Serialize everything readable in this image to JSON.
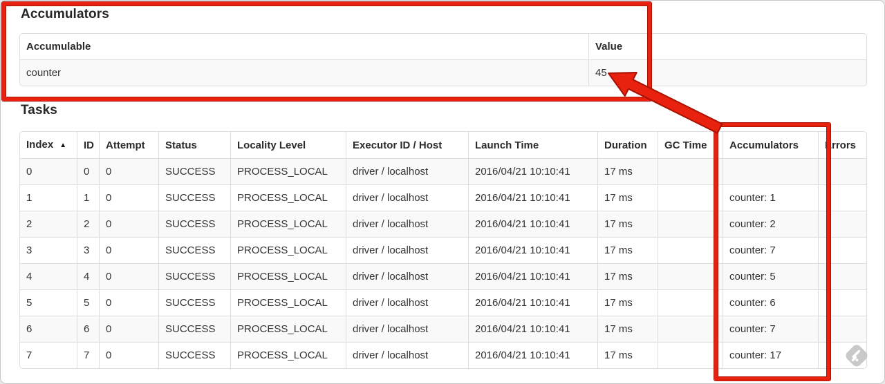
{
  "frame": {
    "background": "#ffffff",
    "border_color": "#c6c6c6"
  },
  "accumulators_section": {
    "title": "Accumulators",
    "table": {
      "columns": [
        "Accumulable",
        "Value"
      ],
      "sorted_column": "",
      "sort_icon": "",
      "rows": [
        [
          "counter",
          "45"
        ]
      ]
    }
  },
  "tasks_section": {
    "title": "Tasks",
    "table": {
      "columns": [
        "Index",
        "ID",
        "Attempt",
        "Status",
        "Locality Level",
        "Executor ID / Host",
        "Launch Time",
        "Duration",
        "GC Time",
        "Accumulators",
        "Errors"
      ],
      "sorted_column": "Index",
      "sort_icon": "▲",
      "rows": [
        [
          "0",
          "0",
          "0",
          "SUCCESS",
          "PROCESS_LOCAL",
          "driver / localhost",
          "2016/04/21 10:10:41",
          "17 ms",
          "",
          "",
          ""
        ],
        [
          "1",
          "1",
          "0",
          "SUCCESS",
          "PROCESS_LOCAL",
          "driver / localhost",
          "2016/04/21 10:10:41",
          "17 ms",
          "",
          "counter: 1",
          ""
        ],
        [
          "2",
          "2",
          "0",
          "SUCCESS",
          "PROCESS_LOCAL",
          "driver / localhost",
          "2016/04/21 10:10:41",
          "17 ms",
          "",
          "counter: 2",
          ""
        ],
        [
          "3",
          "3",
          "0",
          "SUCCESS",
          "PROCESS_LOCAL",
          "driver / localhost",
          "2016/04/21 10:10:41",
          "17 ms",
          "",
          "counter: 7",
          ""
        ],
        [
          "4",
          "4",
          "0",
          "SUCCESS",
          "PROCESS_LOCAL",
          "driver / localhost",
          "2016/04/21 10:10:41",
          "17 ms",
          "",
          "counter: 5",
          ""
        ],
        [
          "5",
          "5",
          "0",
          "SUCCESS",
          "PROCESS_LOCAL",
          "driver / localhost",
          "2016/04/21 10:10:41",
          "17 ms",
          "",
          "counter: 6",
          ""
        ],
        [
          "6",
          "6",
          "0",
          "SUCCESS",
          "PROCESS_LOCAL",
          "driver / localhost",
          "2016/04/21 10:10:41",
          "17 ms",
          "",
          "counter: 7",
          ""
        ],
        [
          "7",
          "7",
          "0",
          "SUCCESS",
          "PROCESS_LOCAL",
          "driver / localhost",
          "2016/04/21 10:10:41",
          "17 ms",
          "",
          "counter: 17",
          ""
        ]
      ]
    }
  },
  "annotations": {
    "highlight_color": "#e8220e",
    "outline_color": "#a81104"
  },
  "watermark": {
    "icon": "feedly-logo-icon",
    "color": "#c9c9c9"
  }
}
